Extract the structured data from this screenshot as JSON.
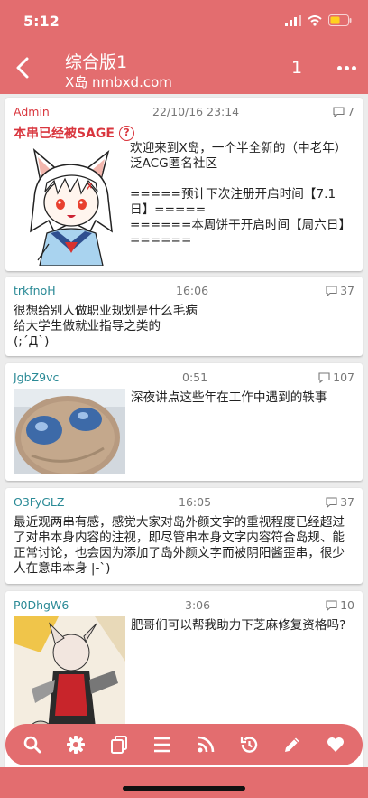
{
  "status": {
    "time": "5:12"
  },
  "header": {
    "title": "综合版1",
    "subtitle": "X岛 nmbxd.com",
    "page": "1"
  },
  "posts": [
    {
      "uid": "Admin",
      "time": "22/10/16 23:14",
      "replies": "7",
      "sage": "本串已经被SAGE",
      "q": "?",
      "text": "欢迎来到X岛，一个半全新的（中老年）泛ACG匿名社区\n\n=====预计下次注册开启时间【7.1日】=====\n======本周饼干开启时间【周六日】======"
    },
    {
      "uid": "trkfnoH",
      "time": "16:06",
      "replies": "37",
      "text": "很想给别人做职业规划是什么毛病\n给大学生做就业指导之类的\n(;´Д`)"
    },
    {
      "uid": "JgbZ9vc",
      "time": "0:51",
      "replies": "107",
      "text": "深夜讲点这些年在工作中遇到的轶事"
    },
    {
      "uid": "O3FyGLZ",
      "time": "16:05",
      "replies": "37",
      "text": "最近观两串有感，感觉大家对岛外颜文字的重视程度已经超过了对串本身内容的注视，即尽管串本身文字内容符合岛规、能正常讨论，也会因为添加了岛外颜文字而被阴阳酱歪串，很少人在意串本身 |-`)"
    },
    {
      "uid": "P0DhgW6",
      "time": "3:06",
      "replies": "10",
      "text": "肥哥们可以帮我助力下芝麻修复资格吗?"
    }
  ],
  "toolbar": [
    "search-icon",
    "gear-icon",
    "copy-icon",
    "list-icon",
    "rss-icon",
    "history-icon",
    "pencil-icon",
    "heart-icon"
  ],
  "colors": {
    "accent": "#e36d6f",
    "admin": "#d9363e",
    "uid": "#2a8a96"
  }
}
